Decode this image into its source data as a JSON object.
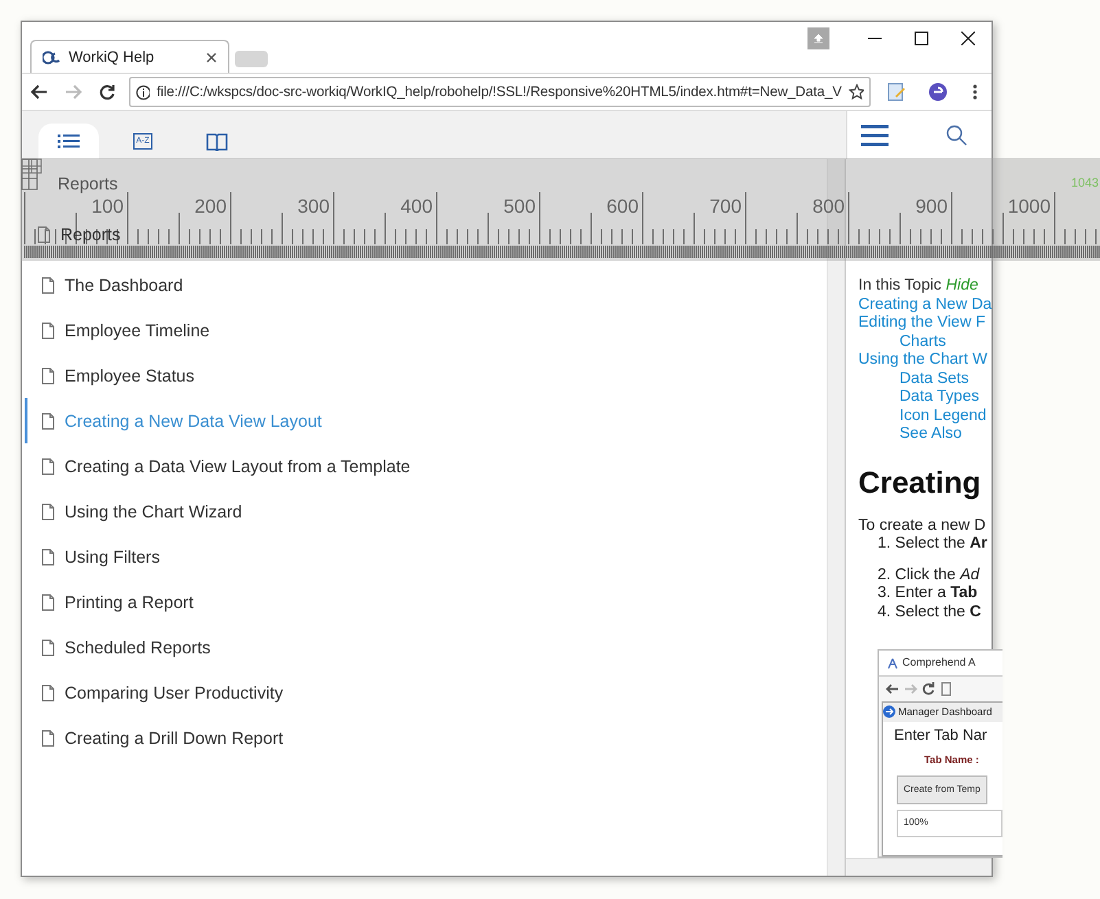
{
  "browser": {
    "tab_title": "WorkiQ Help",
    "url": "file:///C:/wkspcs/doc-src-workiq/WorkIQ_help/robohelp/!SSL!/Responsive%20HTML5/index.htm#t=New_Data_V"
  },
  "help_tabs": [
    {
      "kind": "contents",
      "selected": true
    },
    {
      "kind": "index",
      "selected": false,
      "icon_text": "A-Z"
    },
    {
      "kind": "glossary",
      "selected": false
    }
  ],
  "breadcrumb": "Reports",
  "toc": {
    "folder": "Reports",
    "items": [
      {
        "title": "The Dashboard",
        "selected": false
      },
      {
        "title": "Employee Timeline",
        "selected": false
      },
      {
        "title": "Employee Status",
        "selected": false
      },
      {
        "title": "Creating a New Data View Layout",
        "selected": true
      },
      {
        "title": "Creating a Data View Layout from a Template",
        "selected": false
      },
      {
        "title": "Using the Chart Wizard",
        "selected": false
      },
      {
        "title": "Using Filters",
        "selected": false
      },
      {
        "title": "Printing a Report",
        "selected": false
      },
      {
        "title": "Scheduled Reports",
        "selected": false
      },
      {
        "title": "Comparing User Productivity",
        "selected": false
      },
      {
        "title": "Creating a Drill Down Report",
        "selected": false
      }
    ]
  },
  "ruler": {
    "labels": [
      "100",
      "200",
      "300",
      "400",
      "500",
      "600",
      "700",
      "800",
      "900",
      "1000"
    ],
    "readout": "1043"
  },
  "topic": {
    "toc_label": "In this Topic",
    "toc_toggle": "Hide",
    "toc_links": [
      {
        "text": "Creating a New Da"
      },
      {
        "text": "Editing the View F",
        "children": [
          {
            "text": "Charts"
          }
        ]
      },
      {
        "text": "Using the Chart W",
        "children": [
          {
            "text": "Data Sets"
          },
          {
            "text": "Data Types"
          },
          {
            "text": "Icon Legend"
          },
          {
            "text": "See Also"
          }
        ]
      }
    ],
    "heading": "Creating",
    "intro": "To create a new D",
    "steps": [
      "1. Select the **Ar**",
      "2. Click the *Ad*",
      "3. Enter a **Tab**",
      "4. Select the **C**"
    ],
    "screenshot": {
      "tab": "Comprehend A",
      "bookmark": "Manager Dashboard",
      "title": "Enter Tab Nar",
      "field_label": "Tab Name :",
      "tab_button": "Create from Temp",
      "zoom": "100%"
    }
  }
}
